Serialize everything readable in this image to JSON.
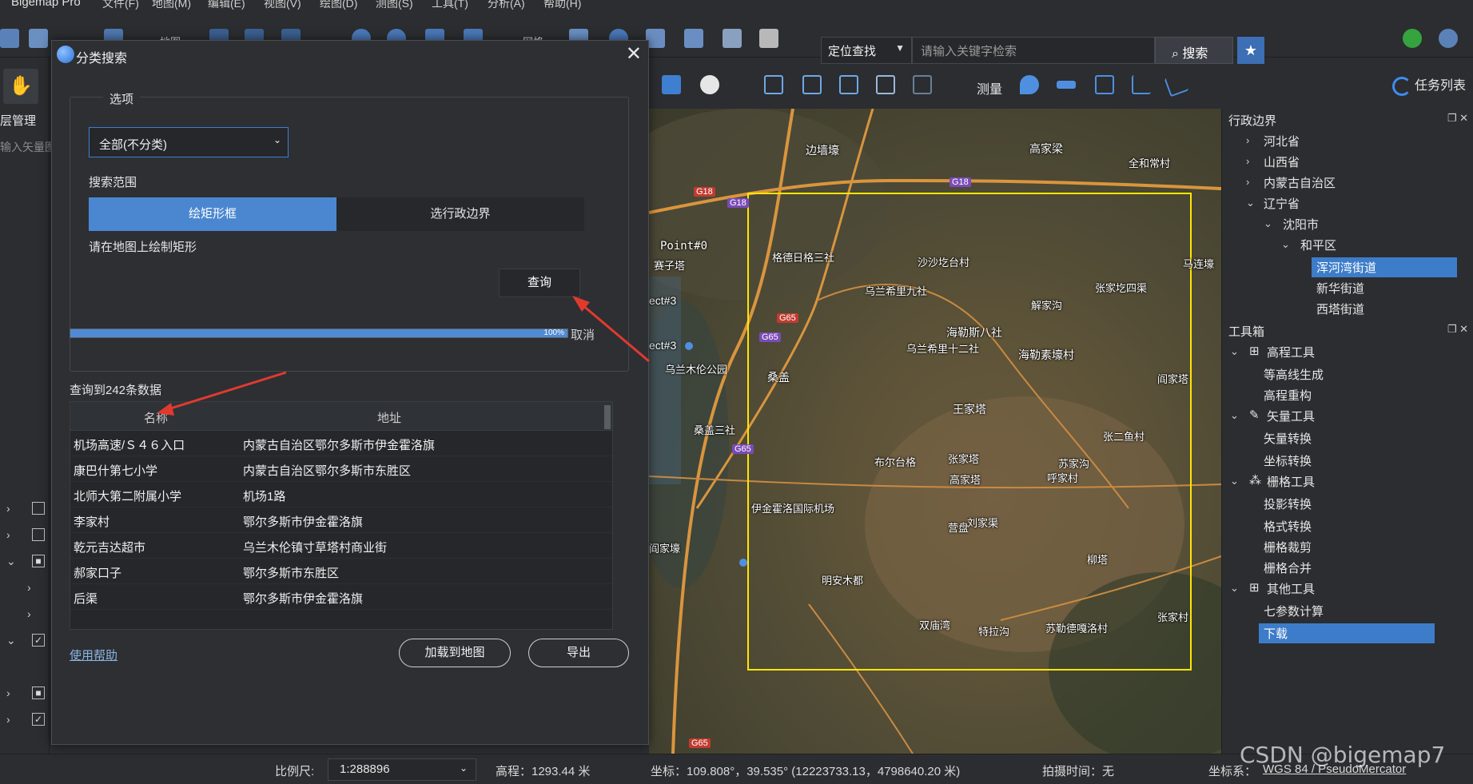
{
  "app": {
    "title": "Bigemap Pro"
  },
  "menubar": {
    "items": [
      "文件(F)",
      "地图(M)",
      "编辑(E)",
      "视图(V)",
      "绘图(D)",
      "测图(S)",
      "工具(T)",
      "分析(A)",
      "帮助(H)"
    ]
  },
  "toolbar": {
    "map_label": "地图",
    "grid_label": "网格",
    "locate_mode": "定位查找",
    "search_placeholder": "请输入关键字检索",
    "search_button": "搜索",
    "measure_label": "测量",
    "task_list": "任务列表"
  },
  "left": {
    "layer_mgmt": "层管理",
    "import_vector": "输入矢量图"
  },
  "dialog": {
    "title": "分类搜索",
    "options_legend": "选项",
    "category_value": "全部(不分类)",
    "range_label": "搜索范围",
    "seg_rect": "绘矩形框",
    "seg_admin": "选行政边界",
    "hint": "请在地图上绘制矩形",
    "query_button": "查询",
    "progress_percent": 100,
    "progress_text": "100%",
    "cancel": "取消",
    "result_count": "查询到242条数据",
    "columns": [
      "名称",
      "地址"
    ],
    "rows": [
      {
        "name": "机场高速/Ｓ４６入口",
        "addr": "内蒙古自治区鄂尔多斯市伊金霍洛旗"
      },
      {
        "name": "康巴什第七小学",
        "addr": "内蒙古自治区鄂尔多斯市东胜区"
      },
      {
        "name": "北师大第二附属小学",
        "addr": "机场1路"
      },
      {
        "name": "李家村",
        "addr": "鄂尔多斯市伊金霍洛旗"
      },
      {
        "name": "乾元吉达超市",
        "addr": "乌兰木伦镇寸草塔村商业街"
      },
      {
        "name": "郝家口子",
        "addr": "鄂尔多斯市东胜区"
      },
      {
        "name": "后渠",
        "addr": "鄂尔多斯市伊金霍洛旗"
      }
    ],
    "help": "使用帮助",
    "load_button": "加载到地图",
    "export_button": "导出"
  },
  "map": {
    "labels": [
      "边墙壕",
      "高家梁",
      "全和常村",
      "格德日格三社",
      "沙沙圪台村",
      "乌兰希里九社",
      "张家圪四渠",
      "解家沟",
      "海勒斯八社",
      "乌兰希里十二社",
      "海勒素壕村",
      "桑盖",
      "桑盖三社",
      "王家塔",
      "张二鱼村",
      "布尔台格",
      "张家塔",
      "高家塔",
      "苏家沟",
      "呼家村",
      "伊金霍洛国际机场",
      "刘家渠",
      "营盘",
      "柳塔",
      "明安木都",
      "双庙湾",
      "特拉沟",
      "苏勒德嘎洛村",
      "张家村",
      "马连壕",
      "阎家塔",
      "赛子塔",
      "Point#0",
      "ect#3",
      "ect#3",
      "乌兰木伦公园",
      "阎家壕"
    ],
    "roads": [
      "G18",
      "G18",
      "G65",
      "G65",
      "G65",
      "G65",
      "G18"
    ]
  },
  "right_panel": {
    "admin_header": "行政边界",
    "admin_items": [
      "河北省",
      "山西省",
      "内蒙古自治区",
      "辽宁省",
      "沈阳市",
      "和平区",
      "浑河湾街道",
      "新华街道",
      "西塔街道"
    ],
    "toolbox_header": "工具箱",
    "tool_groups": [
      {
        "name": "高程工具",
        "items": [
          "等高线生成",
          "高程重构"
        ]
      },
      {
        "name": "矢量工具",
        "items": [
          "矢量转换",
          "坐标转换"
        ]
      },
      {
        "name": "栅格工具",
        "items": [
          "投影转换",
          "格式转换",
          "栅格裁剪",
          "栅格合并"
        ]
      },
      {
        "name": "其他工具",
        "items": [
          "七参数计算",
          "下载"
        ]
      }
    ]
  },
  "status": {
    "scale_label": "比例尺:",
    "scale_value": "1:288896",
    "elevation": "高程：1293.44 米",
    "coords": "坐标：109.808°，39.535°   (12223733.13，4798640.20 米)",
    "capture_time": "拍摄时间：无",
    "crs_label": "坐标系：",
    "crs_value": "WGS 84 / PseudoMercator",
    "watermark": "CSDN @bigemap7"
  },
  "colors": {
    "accent": "#4a87d0",
    "selection_rect": "#ffe600",
    "arrow": "#e03a2f",
    "selected_item": "#3d7cc9"
  }
}
